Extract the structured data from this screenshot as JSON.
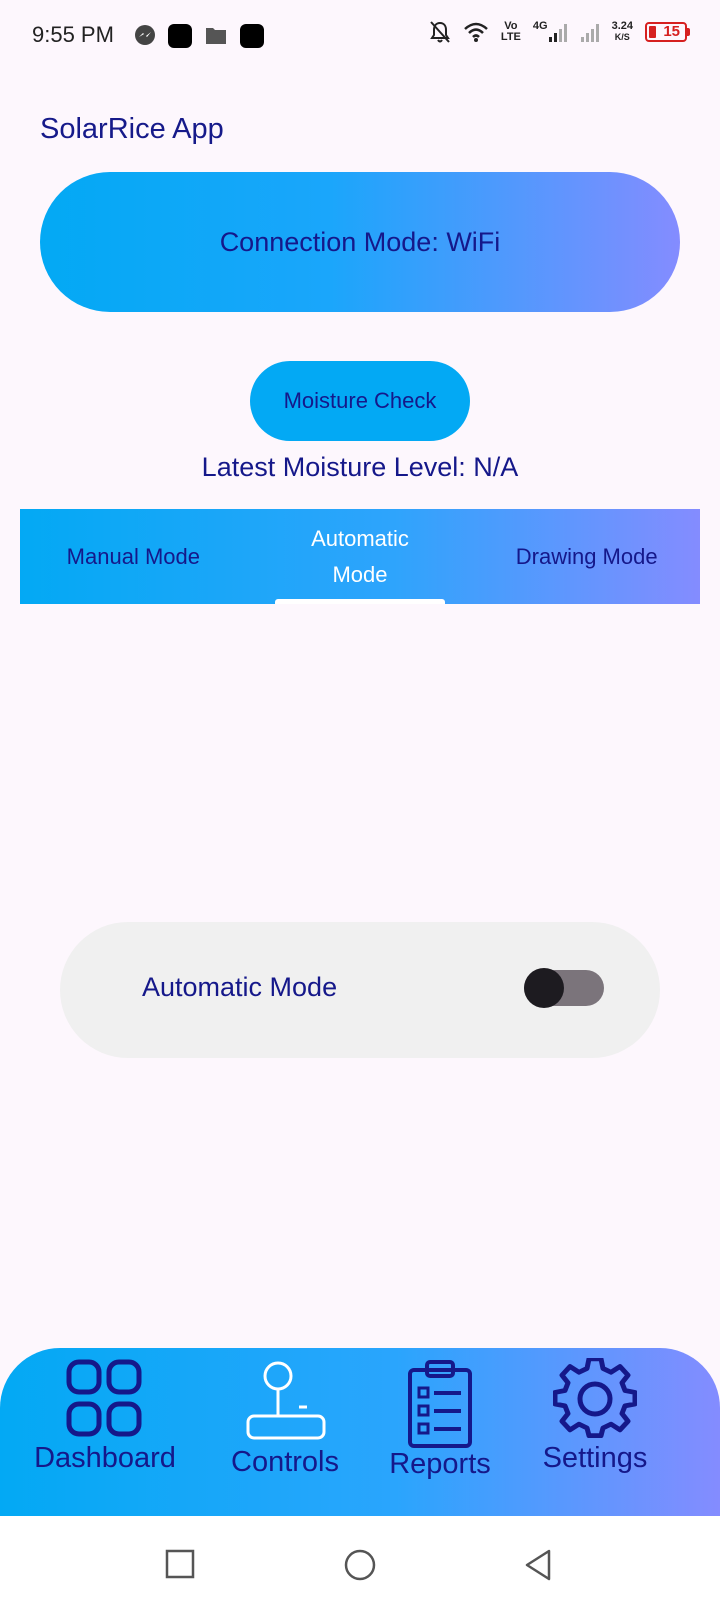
{
  "status_bar": {
    "time": "9:55 PM",
    "network_vo": "Vo",
    "network_lte": "LTE",
    "network_4g": "4G",
    "speed_value": "3.24",
    "speed_unit": "K/S",
    "battery": "15"
  },
  "app": {
    "title": "SolarRice App"
  },
  "connection": {
    "label": "Connection Mode: WiFi"
  },
  "moisture": {
    "button_label": "Moisture Check",
    "latest_label": "Latest Moisture Level: N/A"
  },
  "tabs": [
    {
      "label": "Manual Mode",
      "active": false
    },
    {
      "label": "Automatic Mode",
      "active": true
    },
    {
      "label": "Drawing Mode",
      "active": false
    }
  ],
  "automatic_card": {
    "label": "Automatic Mode",
    "toggle_on": false
  },
  "bottom_nav": [
    {
      "label": "Dashboard",
      "icon": "dashboard-grid-icon"
    },
    {
      "label": "Controls",
      "icon": "joystick-icon"
    },
    {
      "label": "Reports",
      "icon": "clipboard-list-icon"
    },
    {
      "label": "Settings",
      "icon": "gear-icon"
    }
  ],
  "colors": {
    "accent": "#03a9f4",
    "gradient_end": "#848cff",
    "text_primary": "#15188a",
    "background": "#fdf7fd",
    "card": "#f0f0f0"
  }
}
